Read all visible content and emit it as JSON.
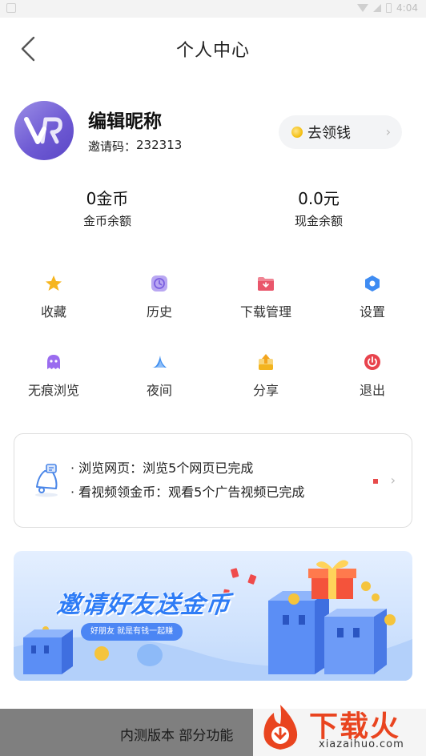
{
  "status_bar": {
    "time": "4:04"
  },
  "header": {
    "title": "个人中心"
  },
  "profile": {
    "nickname": "编辑昵称",
    "invite_label": "邀请码：",
    "invite_code": "232313",
    "earn_button": "去领钱"
  },
  "balances": {
    "coins_value": "0金币",
    "coins_label": "金币余额",
    "cash_value": "0.0元",
    "cash_label": "现金余额"
  },
  "menu": [
    {
      "label": "收藏",
      "icon": "star-icon",
      "color": "#f6b51e"
    },
    {
      "label": "历史",
      "icon": "clock-icon",
      "color": "#9a7ee8"
    },
    {
      "label": "下载管理",
      "icon": "download-folder-icon",
      "color": "#e9566b"
    },
    {
      "label": "设置",
      "icon": "hexagon-settings-icon",
      "color": "#3f8cf2"
    },
    {
      "label": "无痕浏览",
      "icon": "ghost-icon",
      "color": "#9a6cef"
    },
    {
      "label": "夜间",
      "icon": "moon-icon",
      "color": "#3d8ef0"
    },
    {
      "label": "分享",
      "icon": "share-icon",
      "color": "#f3b41e"
    },
    {
      "label": "退出",
      "icon": "power-icon",
      "color": "#e8434d"
    }
  ],
  "tasks": {
    "items": [
      "· 浏览网页：浏览5个网页已完成",
      "· 看视频领金币：观看5个广告视频已完成"
    ]
  },
  "banner": {
    "title": "邀请好友送金币",
    "subtitle": "好朋友 就是有钱一起赚"
  },
  "bottom_bar": {
    "text": "内测版本 部分功能"
  },
  "watermark": {
    "cn": "下载火",
    "en": "xiazaihuo.com"
  }
}
